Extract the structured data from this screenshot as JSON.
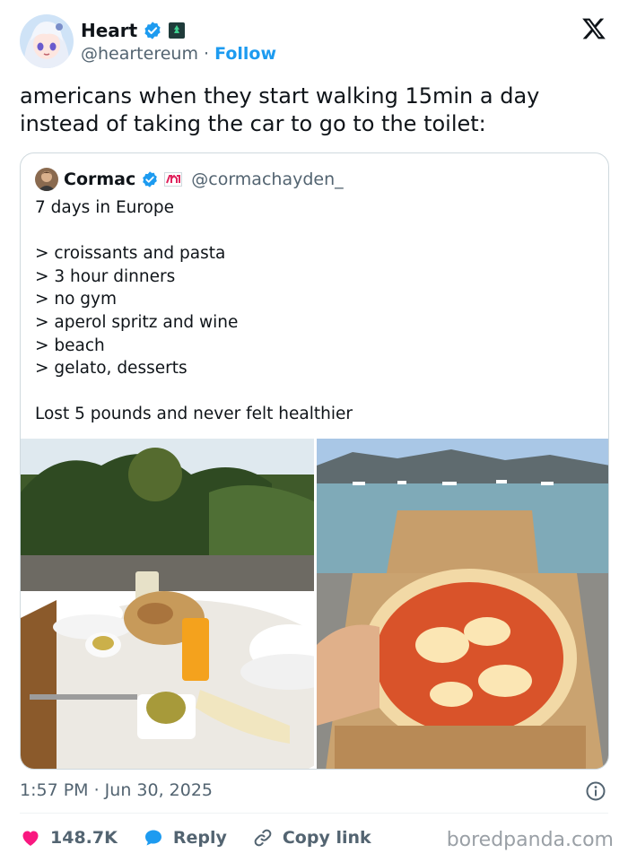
{
  "author": {
    "display_name": "Heart",
    "handle": "@heartereum",
    "separator": "·",
    "follow_label": "Follow"
  },
  "tweet": {
    "text": "americans when they start walking 15min a day\ninstead of taking the car to go to the toilet:",
    "timestamp": "1:57 PM · Jun 30, 2025"
  },
  "quoted": {
    "display_name": "Cormac",
    "handle": "@cormachayden_",
    "text": "7 days in Europe\n\n> croissants and pasta\n> 3 hour dinners\n> no gym\n> aperol spritz and wine\n> beach\n> gelato, desserts\n\nLost 5 pounds and never felt healthier"
  },
  "actions": {
    "likes": "148.7K",
    "reply_label": "Reply",
    "copy_link_label": "Copy link"
  },
  "watermark": "boredpanda.com",
  "icons": {
    "verified": "verified-badge-icon",
    "x_logo": "x-logo-icon",
    "info": "info-icon",
    "like": "heart-icon",
    "reply": "speech-bubble-icon",
    "copy_link": "link-icon"
  },
  "colors": {
    "accent": "#1d9bf0",
    "like": "#f91880",
    "muted": "#536471",
    "border": "#cfd9de"
  }
}
